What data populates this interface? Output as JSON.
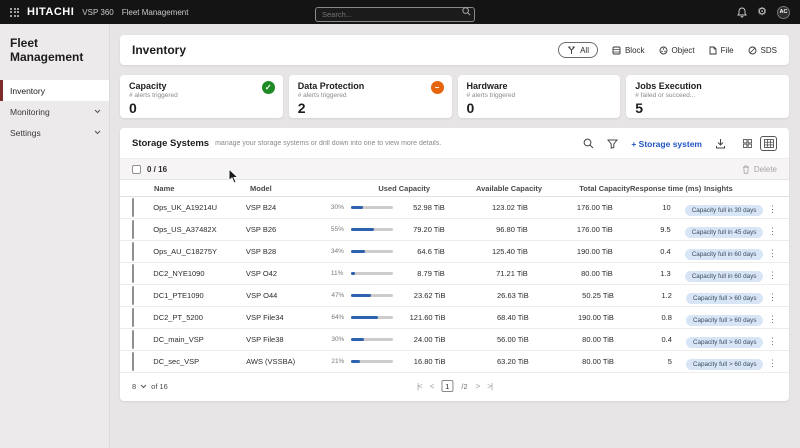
{
  "topbar": {
    "brand": "HITACHI",
    "product": "VSP 360",
    "app": "Fleet Management",
    "search_placeholder": "Search...",
    "avatar_initials": "AC"
  },
  "sidebar": {
    "title": "Fleet Management",
    "items": [
      {
        "label": "Inventory",
        "active": true
      },
      {
        "label": "Monitoring",
        "active": false
      },
      {
        "label": "Settings",
        "active": false
      }
    ]
  },
  "page": {
    "title": "Inventory",
    "view_filters": [
      {
        "label": "All",
        "icon": "all-views-icon",
        "active": true
      },
      {
        "label": "Block",
        "icon": "block-storage-icon",
        "active": false
      },
      {
        "label": "Object",
        "icon": "object-storage-icon",
        "active": false
      },
      {
        "label": "File",
        "icon": "file-storage-icon",
        "active": false
      },
      {
        "label": "SDS",
        "icon": "sds-icon",
        "active": false
      }
    ]
  },
  "summary_cards": [
    {
      "title": "Capacity",
      "subtitle": "# alerts triggered",
      "value": "0",
      "status": "ok",
      "status_glyph": "check"
    },
    {
      "title": "Data Protection",
      "subtitle": "# alerts triggered",
      "value": "2",
      "status": "warning",
      "status_glyph": "minus"
    },
    {
      "title": "Hardware",
      "subtitle": "# alerts triggered",
      "value": "0",
      "status": "ok",
      "status_glyph": "check"
    },
    {
      "title": "Jobs Execution",
      "subtitle": "# failed or succeed...",
      "value": "5",
      "status": "none",
      "status_glyph": ""
    }
  ],
  "storage": {
    "title": "Storage Systems",
    "description": "manage your storage systems or drill down into one to view more details.",
    "add_button": "+ Storage system",
    "selection": {
      "count": "0 / 16",
      "delete_label": "Delete"
    },
    "columns": [
      "Name",
      "Model",
      "Used Capacity",
      "Available Capacity",
      "Total Capacity",
      "Response time (ms)",
      "Insights"
    ],
    "rows": [
      {
        "name": "Ops_UK_A19214U",
        "model": "VSP B24",
        "pct_label": "30%",
        "pct": 30,
        "used": "52.98 TiB",
        "available": "123.02 TiB",
        "total": "176.00 TiB",
        "response": "10",
        "insight": "Capacity full in 30 days"
      },
      {
        "name": "Ops_US_A37482X",
        "model": "VSP B26",
        "pct_label": "55%",
        "pct": 55,
        "used": "79.20 TiB",
        "available": "96.80 TiB",
        "total": "176.00 TiB",
        "response": "9.5",
        "insight": "Capacity full in 45 days"
      },
      {
        "name": "Ops_AU_C18275Y",
        "model": "VSP B28",
        "pct_label": "34%",
        "pct": 34,
        "used": "64.6 TiB",
        "available": "125.40 TiB",
        "total": "190.00 TiB",
        "response": "0.4",
        "insight": "Capacity full in 60 days"
      },
      {
        "name": "DC2_NYE1090",
        "model": "VSP O42",
        "pct_label": "11%",
        "pct": 11,
        "used": "8.79 TiB",
        "available": "71.21 TiB",
        "total": "80.00 TiB",
        "response": "1.3",
        "insight": "Capacity full in 60 days"
      },
      {
        "name": "DC1_PTE1090",
        "model": "VSP O44",
        "pct_label": "47%",
        "pct": 47,
        "used": "23.62 TiB",
        "available": "26.63 TiB",
        "total": "50.25 TiB",
        "response": "1.2",
        "insight": "Capacity full > 60 days"
      },
      {
        "name": "DC2_PT_5200",
        "model": "VSP File34",
        "pct_label": "64%",
        "pct": 64,
        "used": "121.60 TiB",
        "available": "68.40 TiB",
        "total": "190.00 TiB",
        "response": "0.8",
        "insight": "Capacity full > 60 days"
      },
      {
        "name": "DC_main_VSP",
        "model": "VSP File38",
        "pct_label": "30%",
        "pct": 30,
        "used": "24.00 TiB",
        "available": "56.00 TiB",
        "total": "80.00 TiB",
        "response": "0.4",
        "insight": "Capacity full > 60 days"
      },
      {
        "name": "DC_sec_VSP",
        "model": "AWS (VSSBA)",
        "pct_label": "21%",
        "pct": 21,
        "used": "16.80 TiB",
        "available": "63.20 TiB",
        "total": "80.00 TiB",
        "response": "5",
        "insight": "Capacity full > 60 days"
      }
    ],
    "pagination": {
      "rows_per_page": "8",
      "of_label": "of 16",
      "first": "|<",
      "prev": "<",
      "current_page": "1",
      "pages_suffix": "/2",
      "next": ">",
      "last": ">|"
    }
  },
  "colors": {
    "topbar_bg": "#141414",
    "sidebar_active_red": "#7d2b2b",
    "ok_green": "#1e8a24",
    "warn_orange": "#e8650f",
    "link_blue": "#2355c4",
    "badge_bg": "#d7e5f6",
    "bar_fill_blue": "#2d62b0"
  }
}
